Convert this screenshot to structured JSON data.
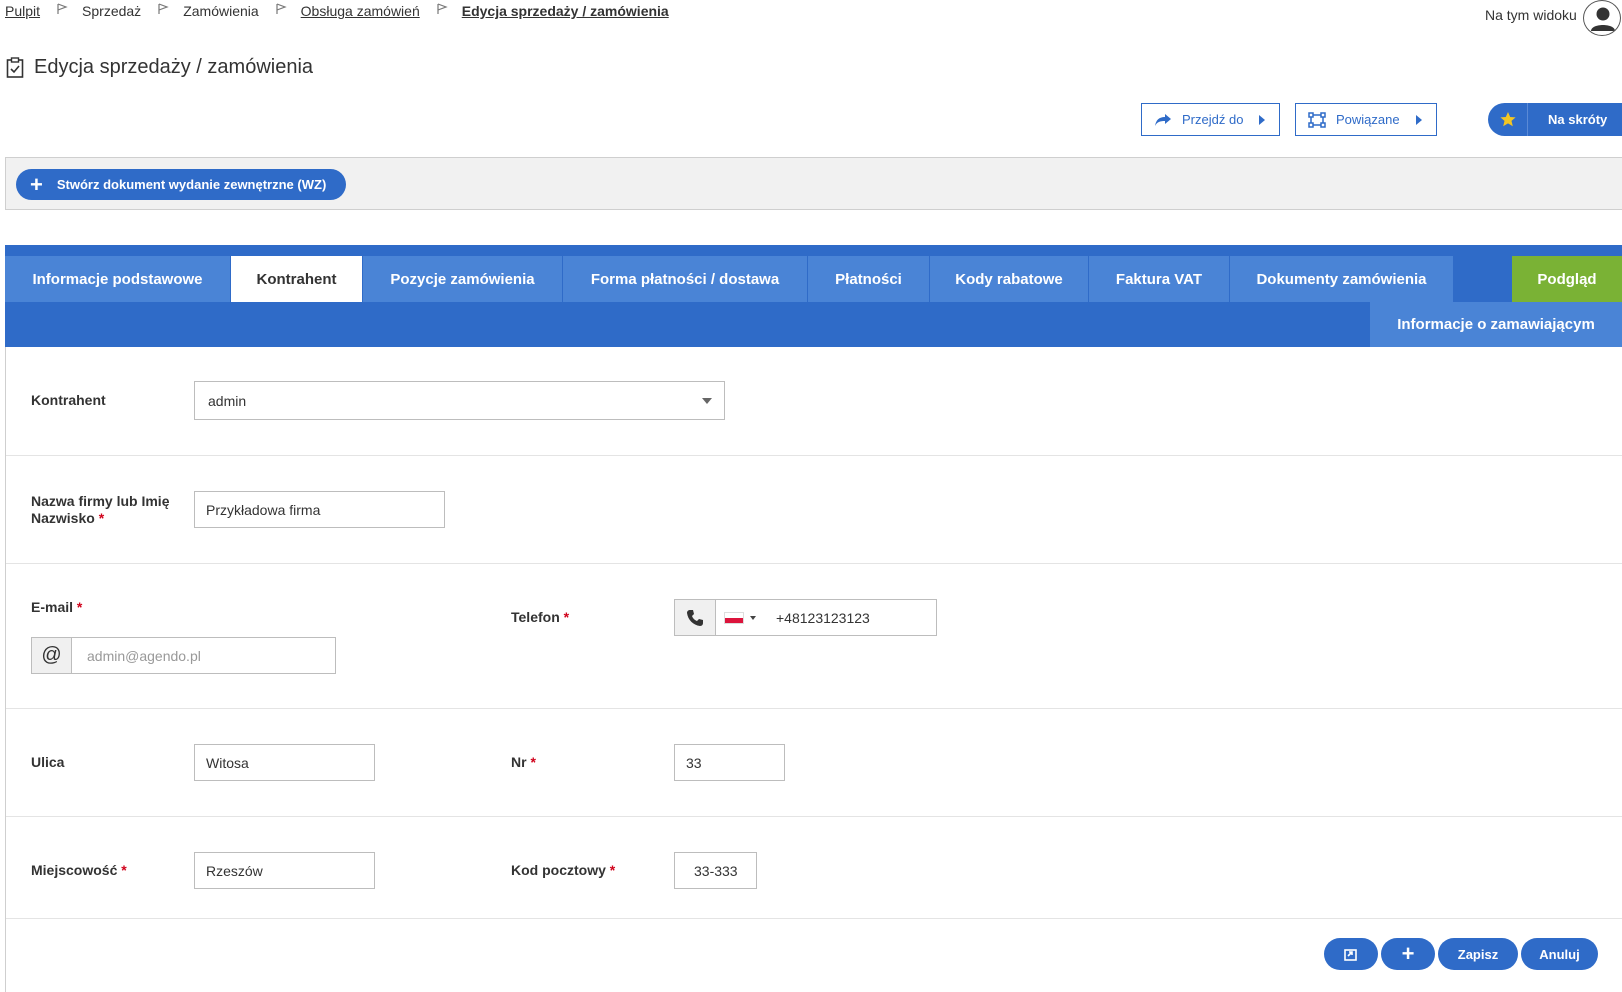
{
  "breadcrumb": {
    "items": [
      "Pulpit",
      "Sprzedaż",
      "Zamówienia",
      "Obsługa zamówień",
      "Edycja sprzedaży / zamówienia"
    ]
  },
  "header": {
    "view_label": "Na tym widoku",
    "title": "Edycja sprzedaży / zamówienia"
  },
  "actions": {
    "goto_label": "Przejdź do",
    "related_label": "Powiązane",
    "shortcuts_label": "Na skróty"
  },
  "toolbar": {
    "create_wz_label": "Stwórz dokument wydanie zewnętrzne (WZ)"
  },
  "tabs": [
    {
      "label": "Informacje podstawowe"
    },
    {
      "label": "Kontrahent"
    },
    {
      "label": "Pozycje zamówienia"
    },
    {
      "label": "Forma płatności / dostawa"
    },
    {
      "label": "Płatności"
    },
    {
      "label": "Kody rabatowe"
    },
    {
      "label": "Faktura VAT"
    },
    {
      "label": "Dokumenty zamówienia"
    }
  ],
  "preview_tab": "Podgląd",
  "subtab": "Informacje o zamawiającym",
  "form": {
    "contractor": {
      "label": "Kontrahent",
      "value": "admin"
    },
    "company": {
      "label_line1": "Nazwa firmy lub Imię",
      "label_line2": "Nazwisko",
      "value": "Przykładowa firma"
    },
    "email": {
      "label": "E-mail",
      "placeholder": "admin@agendo.pl",
      "addon": "@"
    },
    "phone": {
      "label": "Telefon",
      "value": "+48123123123"
    },
    "street": {
      "label": "Ulica",
      "value": "Witosa"
    },
    "number": {
      "label": "Nr",
      "value": "33"
    },
    "city": {
      "label": "Miejscowość",
      "value": "Rzeszów"
    },
    "postal": {
      "label": "Kod pocztowy",
      "value": "33-333"
    },
    "required_mark": "*"
  },
  "buttons": {
    "save": "Zapisz",
    "cancel": "Anuluj",
    "add": "+"
  },
  "colors": {
    "primary": "#2f6bc8",
    "tab": "#4a84d6",
    "preview": "#7ab235",
    "required": "#d0021b"
  }
}
